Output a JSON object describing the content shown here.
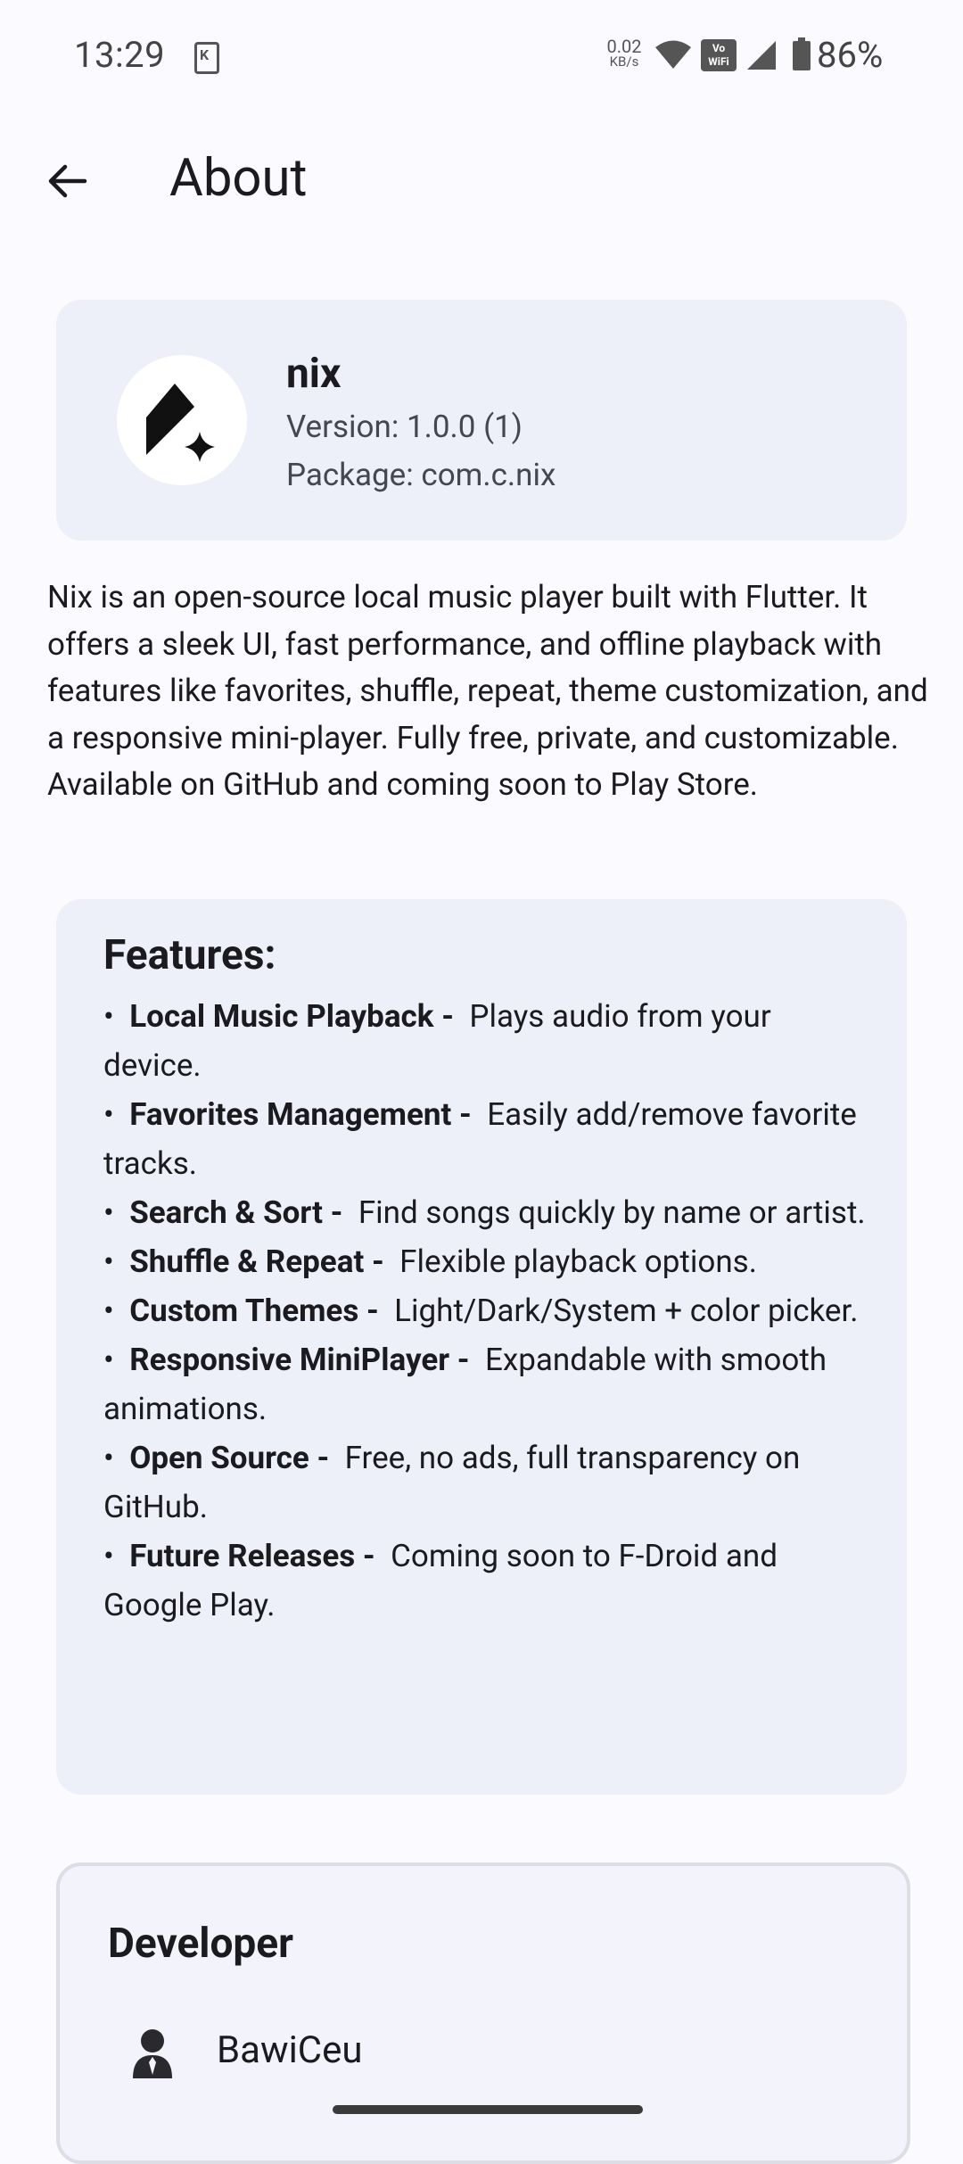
{
  "status_bar": {
    "time": "13:29",
    "net_speed_value": "0.02",
    "net_speed_unit": "KB/s",
    "vowifi_label": "Vo WiFi",
    "battery_percent": "86%"
  },
  "app_bar": {
    "title": "About"
  },
  "app_info": {
    "name": "nix",
    "version": "Version: 1.0.0 (1)",
    "package": "Package: com.c.nix"
  },
  "description": "Nix is an open-source local music player built with Flutter. It offers a sleek UI, fast performance, and offline playback with features like favorites, shuffle, repeat, theme customization, and a responsive mini-player. Fully free, private, and customizable. Available on GitHub and coming soon to Play Store.",
  "features": {
    "title": "Features:",
    "items": [
      {
        "name": "Local Music Playback -",
        "text": "Plays audio from your device."
      },
      {
        "name": "Favorites Management -",
        "text": "Easily add/remove favorite tracks."
      },
      {
        "name": "Search & Sort -",
        "text": "Find songs quickly by name or artist."
      },
      {
        "name": "Shuffle & Repeat -",
        "text": "Flexible playback options."
      },
      {
        "name": "Custom Themes -",
        "text": "Light/Dark/System + color picker."
      },
      {
        "name": "Responsive MiniPlayer -",
        "text": "Expandable with smooth animations."
      },
      {
        "name": "Open Source -",
        "text": "Free, no ads, full transparency on GitHub."
      },
      {
        "name": "Future Releases -",
        "text": "Coming soon to F-Droid and Google Play."
      }
    ]
  },
  "developer": {
    "title": "Developer",
    "name": "BawiCeu"
  },
  "icons": {
    "back": "arrow-left-icon",
    "app_logo": "nix-logo-icon",
    "developer": "person-icon"
  },
  "colors": {
    "background": "#fbfbff",
    "card": "#eef0f9",
    "text": "#1b1b1f",
    "secondary_text": "#45464f"
  }
}
